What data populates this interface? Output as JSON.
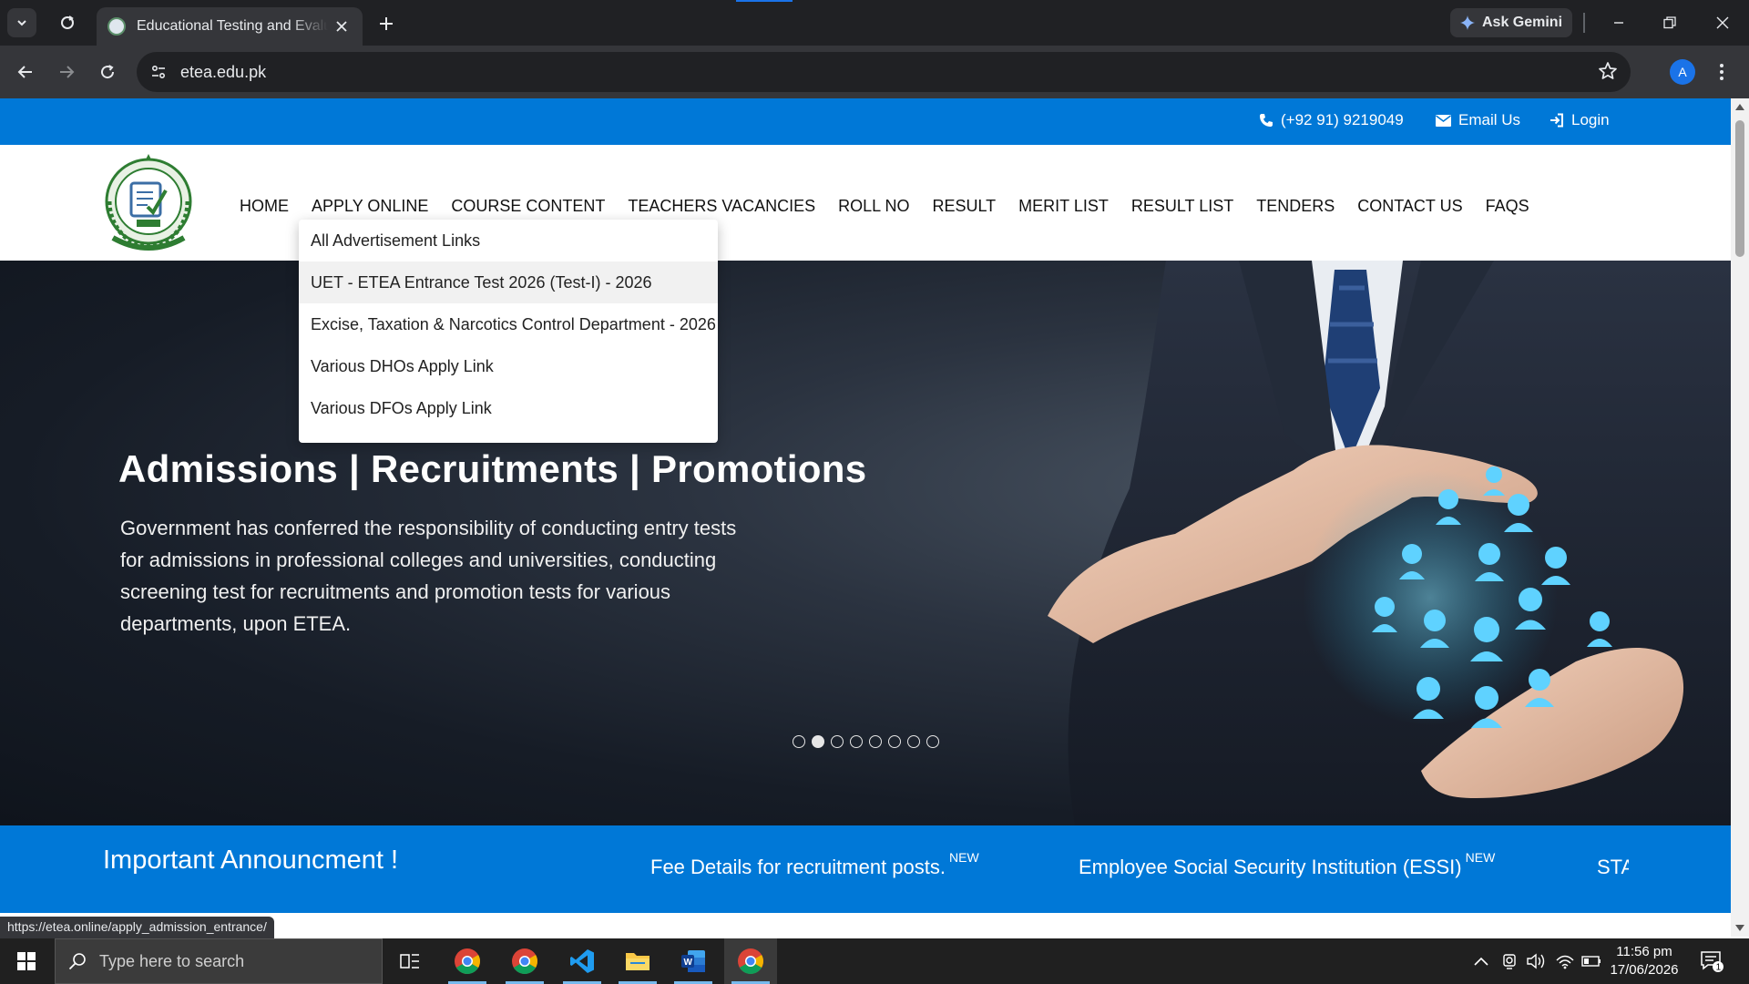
{
  "browser": {
    "tab_title": "Educational Testing and Evaluation Agency",
    "url": "etea.edu.pk",
    "ask_gemini": "Ask Gemini",
    "profile_initial": "A",
    "status_url": "https://etea.online/apply_admission_entrance/"
  },
  "topbar": {
    "phone": "(+92 91) 9219049",
    "email": "Email Us",
    "login": "Login"
  },
  "nav": {
    "items": [
      "HOME",
      "APPLY ONLINE",
      "COURSE CONTENT",
      "TEACHERS VACANCIES",
      "ROLL NO",
      "RESULT",
      "MERIT LIST",
      "RESULT LIST",
      "TENDERS",
      "CONTACT US",
      "FAQS"
    ]
  },
  "dropdown": {
    "items": [
      "All Advertisement Links",
      "UET - ETEA Entrance Test 2026 (Test-I) - 2026",
      "Excise, Taxation & Narcotics Control Department - 2026",
      "Various DHOs Apply Link",
      "Various DFOs Apply Link"
    ],
    "active_index": 1
  },
  "hero": {
    "heading": "Admissions | Recruitments | Promotions",
    "text": "Government has conferred the responsibility of conducting entry tests for admissions in professional colleges and universities, conducting screening test for recruitments and promotion tests for various departments, upon ETEA.",
    "slide_count": 8,
    "active_slide": 1
  },
  "announcement": {
    "title": "Important Announcment !",
    "items": [
      {
        "text": "Fee Details for recruitment posts.",
        "badge": "NEW"
      },
      {
        "text": "Employee Social Security Institution (ESSI)",
        "badge": "NEW"
      },
      {
        "text": "STA",
        "badge": ""
      }
    ]
  },
  "taskbar": {
    "search_placeholder": "Type here to search",
    "time": "11:56 pm",
    "date": "17/06/2026",
    "notification_count": "1"
  },
  "colors": {
    "brand_blue": "#0078d7",
    "chrome_dark": "#202124",
    "chrome_mid": "#35363a"
  }
}
